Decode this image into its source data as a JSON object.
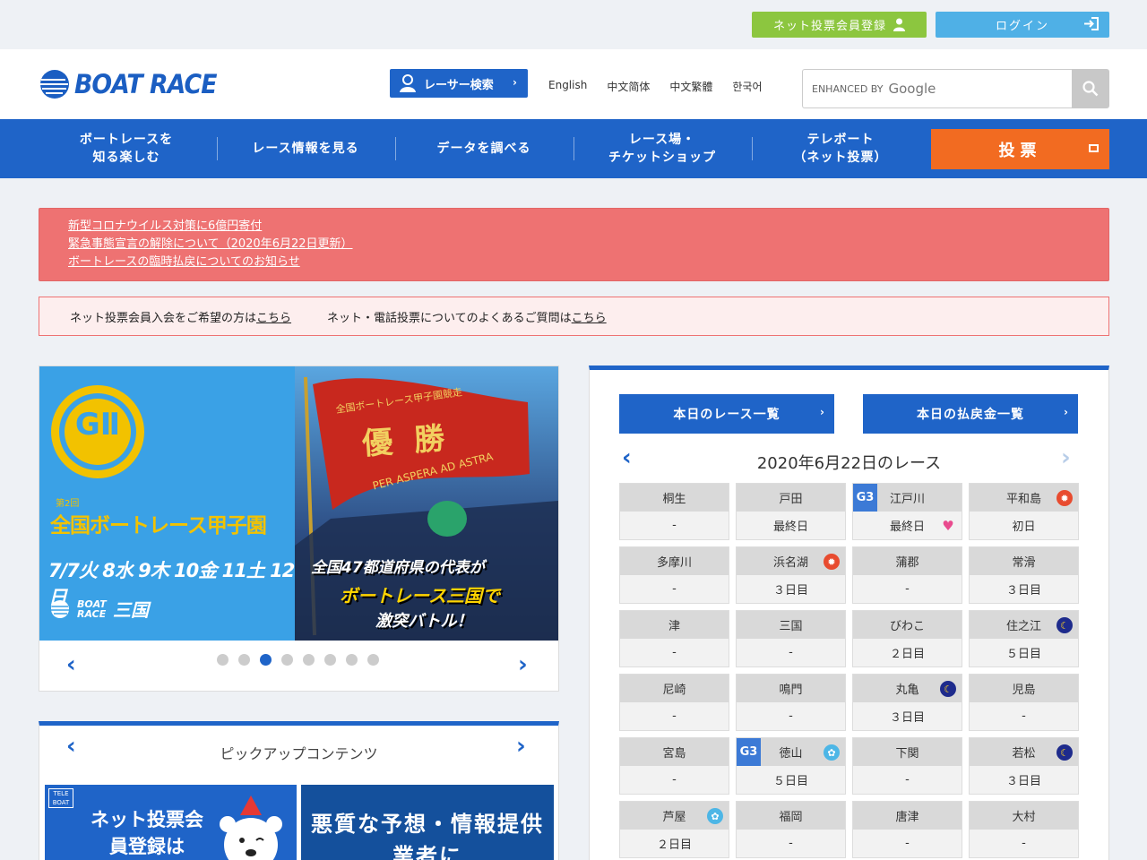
{
  "topbar": {
    "register_label": "ネット投票会員登録",
    "login_label": "ログイン"
  },
  "header": {
    "logo_text": "BOAT RACE",
    "racer_search_label": "レーサー検索",
    "languages": [
      "English",
      "中文简体",
      "中文繁體",
      "한국어"
    ],
    "search_placeholder_prefix": "ENHANCED BY",
    "search_placeholder_brand": "Google"
  },
  "nav": {
    "items": [
      {
        "line1": "ボートレースを",
        "line2": "知る楽しむ"
      },
      {
        "line1": "レース情報を見る",
        "line2": ""
      },
      {
        "line1": "データを調べる",
        "line2": ""
      },
      {
        "line1": "レース場・",
        "line2": "チケットショップ"
      },
      {
        "line1": "テレボート",
        "line2": "（ネット投票）"
      }
    ],
    "vote_label": "投票"
  },
  "alerts": [
    "新型コロナウイルス対策に6億円寄付",
    "緊急事態宣言の解除について（2020年6月22日更新）",
    "ボートレースの臨時払戻についてのお知らせ"
  ],
  "info": {
    "text1": "ネット投票会員入会をご希望の方は",
    "link1": "こちら",
    "text2": "ネット・電話投票についてのよくあるご質問は",
    "link2": "こちら"
  },
  "banner": {
    "grade": "GⅡ",
    "edition": "第2回",
    "title": "全国ボートレース甲子園",
    "dates": "7/7火 8水 9木 10金 11土 12日",
    "venue": "三国",
    "flag_title": "全国ボートレース甲子園競走",
    "flag_main": "優勝",
    "flag_motto": "PER ASPERA AD ASTRA",
    "catch1": "全国47都道府県の代表が",
    "catch2": "ボートレース三国で",
    "catch3": "激突バトル！",
    "slide_count": 8,
    "active_slide": 3
  },
  "pickup": {
    "title": "ピックアップコンテンツ",
    "card1_text": "ネット投票会員登録は",
    "card2_text": "悪質な予想・情報提供業者に"
  },
  "race_panel": {
    "btn_races": "本日のレース一覧",
    "btn_payouts": "本日の払戻金一覧",
    "date_title": "2020年6月22日のレース",
    "colors": {
      "sun": "#e84b2f",
      "moon": "#1e2b8c",
      "morning": "#4db6e6",
      "heart": "#e94b8e",
      "g3": "#3c7ad6"
    },
    "venues": [
      {
        "name": "桐生",
        "status": "-",
        "grade": "",
        "icon": ""
      },
      {
        "name": "戸田",
        "status": "最終日",
        "grade": "",
        "icon": ""
      },
      {
        "name": "江戸川",
        "status": "最終日",
        "grade": "G3",
        "icon": "heart-icon"
      },
      {
        "name": "平和島",
        "status": "初日",
        "grade": "",
        "icon": "sun-icon"
      },
      {
        "name": "多摩川",
        "status": "-",
        "grade": "",
        "icon": ""
      },
      {
        "name": "浜名湖",
        "status": "３日目",
        "grade": "",
        "icon": "sun-icon"
      },
      {
        "name": "蒲郡",
        "status": "-",
        "grade": "",
        "icon": ""
      },
      {
        "name": "常滑",
        "status": "３日目",
        "grade": "",
        "icon": ""
      },
      {
        "name": "津",
        "status": "-",
        "grade": "",
        "icon": ""
      },
      {
        "name": "三国",
        "status": "-",
        "grade": "",
        "icon": ""
      },
      {
        "name": "びわこ",
        "status": "２日目",
        "grade": "",
        "icon": ""
      },
      {
        "name": "住之江",
        "status": "５日目",
        "grade": "",
        "icon": "moon-icon"
      },
      {
        "name": "尼崎",
        "status": "-",
        "grade": "",
        "icon": ""
      },
      {
        "name": "鳴門",
        "status": "-",
        "grade": "",
        "icon": ""
      },
      {
        "name": "丸亀",
        "status": "３日目",
        "grade": "",
        "icon": "moon-icon"
      },
      {
        "name": "児島",
        "status": "-",
        "grade": "",
        "icon": ""
      },
      {
        "name": "宮島",
        "status": "-",
        "grade": "",
        "icon": ""
      },
      {
        "name": "徳山",
        "status": "５日目",
        "grade": "G3",
        "icon": "morning-icon"
      },
      {
        "name": "下関",
        "status": "-",
        "grade": "",
        "icon": ""
      },
      {
        "name": "若松",
        "status": "３日目",
        "grade": "",
        "icon": "moon-icon"
      },
      {
        "name": "芦屋",
        "status": "２日目",
        "grade": "",
        "icon": "morning-icon"
      },
      {
        "name": "福岡",
        "status": "-",
        "grade": "",
        "icon": ""
      },
      {
        "name": "唐津",
        "status": "-",
        "grade": "",
        "icon": ""
      },
      {
        "name": "大村",
        "status": "-",
        "grade": "",
        "icon": ""
      }
    ]
  }
}
